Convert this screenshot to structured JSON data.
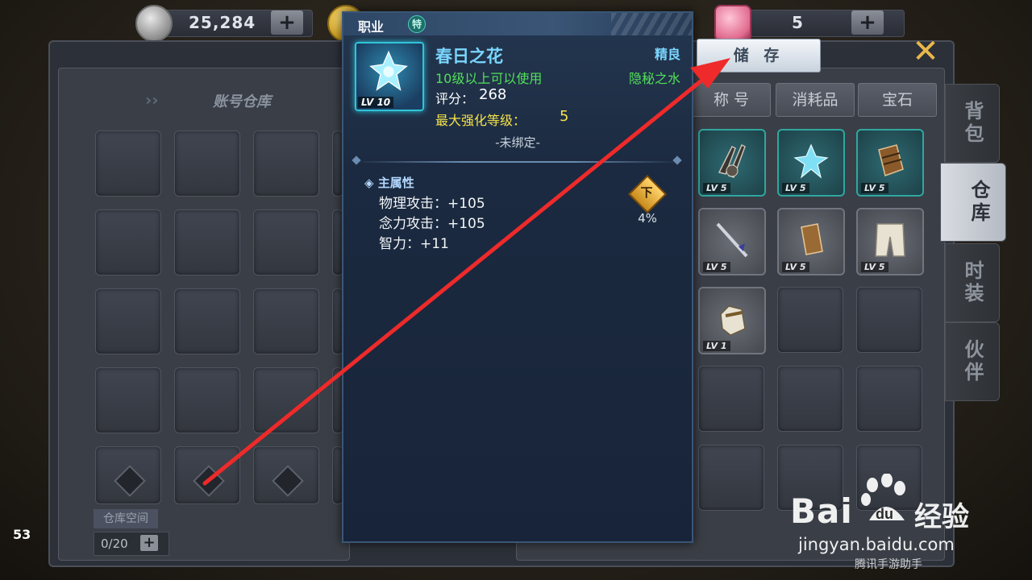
{
  "currency": {
    "silver_value": "25,284",
    "gem_value": "5",
    "plus_label": "+"
  },
  "warehouse": {
    "title": "账号仓库",
    "space_label": "仓库空间",
    "space_count": "0/20",
    "plus_label": "+"
  },
  "categories": [
    "称 号",
    "消耗品",
    "宝石"
  ],
  "side_tabs": [
    "背包",
    "仓库",
    "时装",
    "伙伴"
  ],
  "inventory_levels": [
    "LV 5",
    "LV 5",
    "LV 5",
    "LV 5",
    "LV 5",
    "LV 5",
    "LV 1"
  ],
  "tooltip": {
    "job_label": "职业",
    "job_badge": "特",
    "item_level": "LV 10",
    "name": "春日之花",
    "quality": "精良",
    "requirement": "10级以上可以使用",
    "set_name": "隐秘之水",
    "score_label": "评分：",
    "score_value": "268",
    "enhance_label": "最大强化等级：",
    "enhance_value": "5",
    "bind_status": "-未绑定-",
    "main_attr_title": "主属性",
    "attributes": [
      "物理攻击：+105",
      "念力攻击：+105",
      "智力：+11"
    ],
    "compare_badge": "下",
    "compare_percent": "4%"
  },
  "save_button": "储 存",
  "fps": "53",
  "watermark": {
    "logo": "Bai",
    "logo_du": "du",
    "jingyan": "经验",
    "url": "jingyan.baidu.com",
    "tencent": "腾讯手游助手"
  },
  "colors": {
    "name_color": "#7ad6ff",
    "requirement_color": "#53e05a",
    "enhance_color": "#f4e24a",
    "arrow_color": "#ee2a2a"
  }
}
